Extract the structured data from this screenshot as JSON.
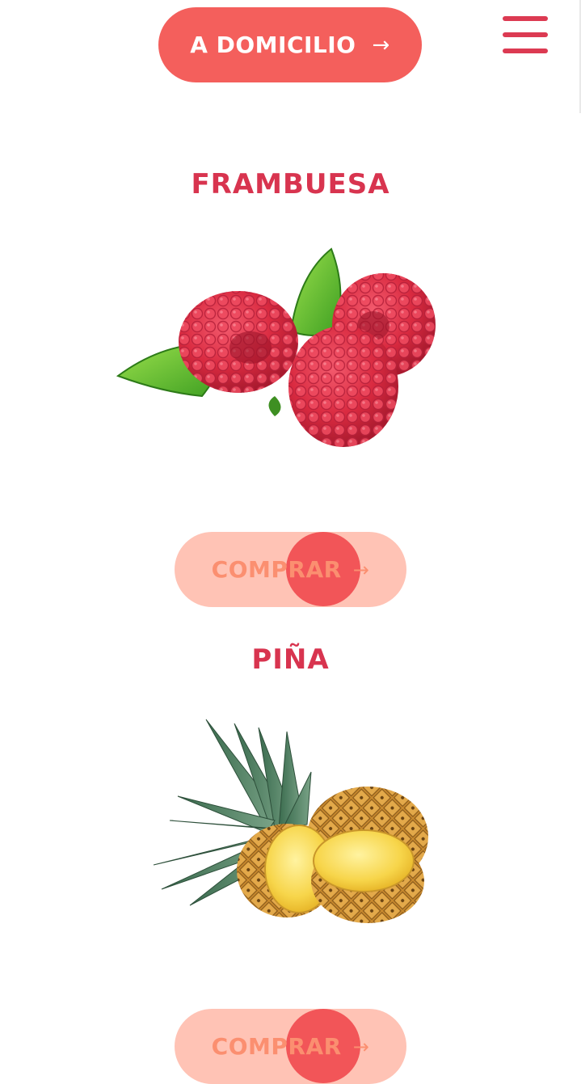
{
  "header": {
    "delivery_button": "A DOMICILIO",
    "delivery_arrow": "→",
    "menu_icon": "hamburger-menu-icon"
  },
  "products": [
    {
      "name": "FRAMBUESA",
      "image": "raspberries",
      "button_label": "COMPRAR",
      "button_arrow": "→"
    },
    {
      "name": "PIÑA",
      "image": "pineapple",
      "button_label": "COMPRAR",
      "button_arrow": "→"
    }
  ],
  "colors": {
    "primary": "#f45f5c",
    "title": "#d8344f",
    "button_soft": "#ffc3b5",
    "button_soft_text": "#fb8f70"
  }
}
